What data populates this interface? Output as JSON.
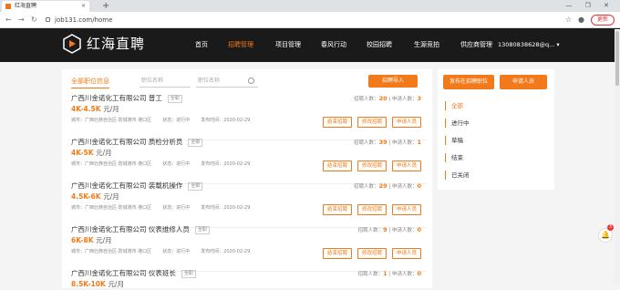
{
  "browser": {
    "tab_title": "红海直聘",
    "tab_close": "×",
    "new_tab": "+",
    "url": "job131.com/home",
    "update_label": "更新",
    "window_controls": "— ❐ ✕"
  },
  "header": {
    "brand": "红海直聘",
    "nav": [
      "首页",
      "招聘管理",
      "项目管理",
      "春风行动",
      "校园招聘",
      "生源竞拍",
      "供应商管理"
    ],
    "active_nav": 1,
    "user": "13080838628@q... ▾"
  },
  "filters": {
    "tab_all": "全部职位信息",
    "job_name_placeholder": "职位名称",
    "position_name_placeholder": "职位名称",
    "post_button": "招聘导入"
  },
  "jobs": [
    {
      "title": "广西川金诺化工有限公司 普工",
      "tag": "全职",
      "salary": "4K-4.5K",
      "unit": "元/月",
      "city": "城市：广西壮族自治区·防城港市·港口区",
      "status": "状态：进行中",
      "date": "发布时间：2020-02-29",
      "recruit_label": "招聘人数：",
      "recruit": "20",
      "apply_label": "| 申请人数：",
      "apply": "3"
    },
    {
      "title": "广西川金诺化工有限公司 质检分析员",
      "tag": "全职",
      "salary": "4K-5K",
      "unit": "元/月",
      "city": "城市：广西壮族自治区·防城港市·港口区",
      "status": "状态：进行中",
      "date": "发布时间：2020-02-29",
      "recruit_label": "招聘人数：",
      "recruit": "39",
      "apply_label": "| 申请人数：",
      "apply": "1"
    },
    {
      "title": "广西川金诺化工有限公司 装载机操作",
      "tag": "全职",
      "salary": "4.5K-6K",
      "unit": "元/月",
      "city": "城市：广西壮族自治区·防城港市·港口区",
      "status": "状态：进行中",
      "date": "发布时间：2020-02-29",
      "recruit_label": "招聘人数：",
      "recruit": "29",
      "apply_label": "| 申请人数：",
      "apply": "0"
    },
    {
      "title": "广西川金诺化工有限公司 仪表维修人员",
      "tag": "全职",
      "salary": "6K-8K",
      "unit": "元/月",
      "city": "城市：广西壮族自治区·防城港市·港口区",
      "status": "状态：进行中",
      "date": "发布时间：2020-02-29",
      "recruit_label": "招聘人数：",
      "recruit": "9",
      "apply_label": "| 申请人数：",
      "apply": "0"
    },
    {
      "title": "广西川金诺化工有限公司 仪表班长",
      "tag": "全职",
      "salary": "8.5K-10K",
      "unit": "元/月",
      "city": "",
      "status": "",
      "date": "",
      "recruit_label": "招聘人数：",
      "recruit": "1",
      "apply_label": "| 申请人数：",
      "apply": "0"
    }
  ],
  "job_buttons": {
    "end": "结束招聘",
    "edit": "修改招聘",
    "applicants": "申请人员"
  },
  "side": {
    "publish": "发布在招聘职位",
    "applicants": "申请人员",
    "filters": [
      "全部",
      "进行中",
      "草稿",
      "结束",
      "已关闭"
    ],
    "active": 0
  },
  "bell_badge": "3",
  "colors": {
    "accent": "#f27a1a",
    "header_bg": "#1a1a1a"
  }
}
